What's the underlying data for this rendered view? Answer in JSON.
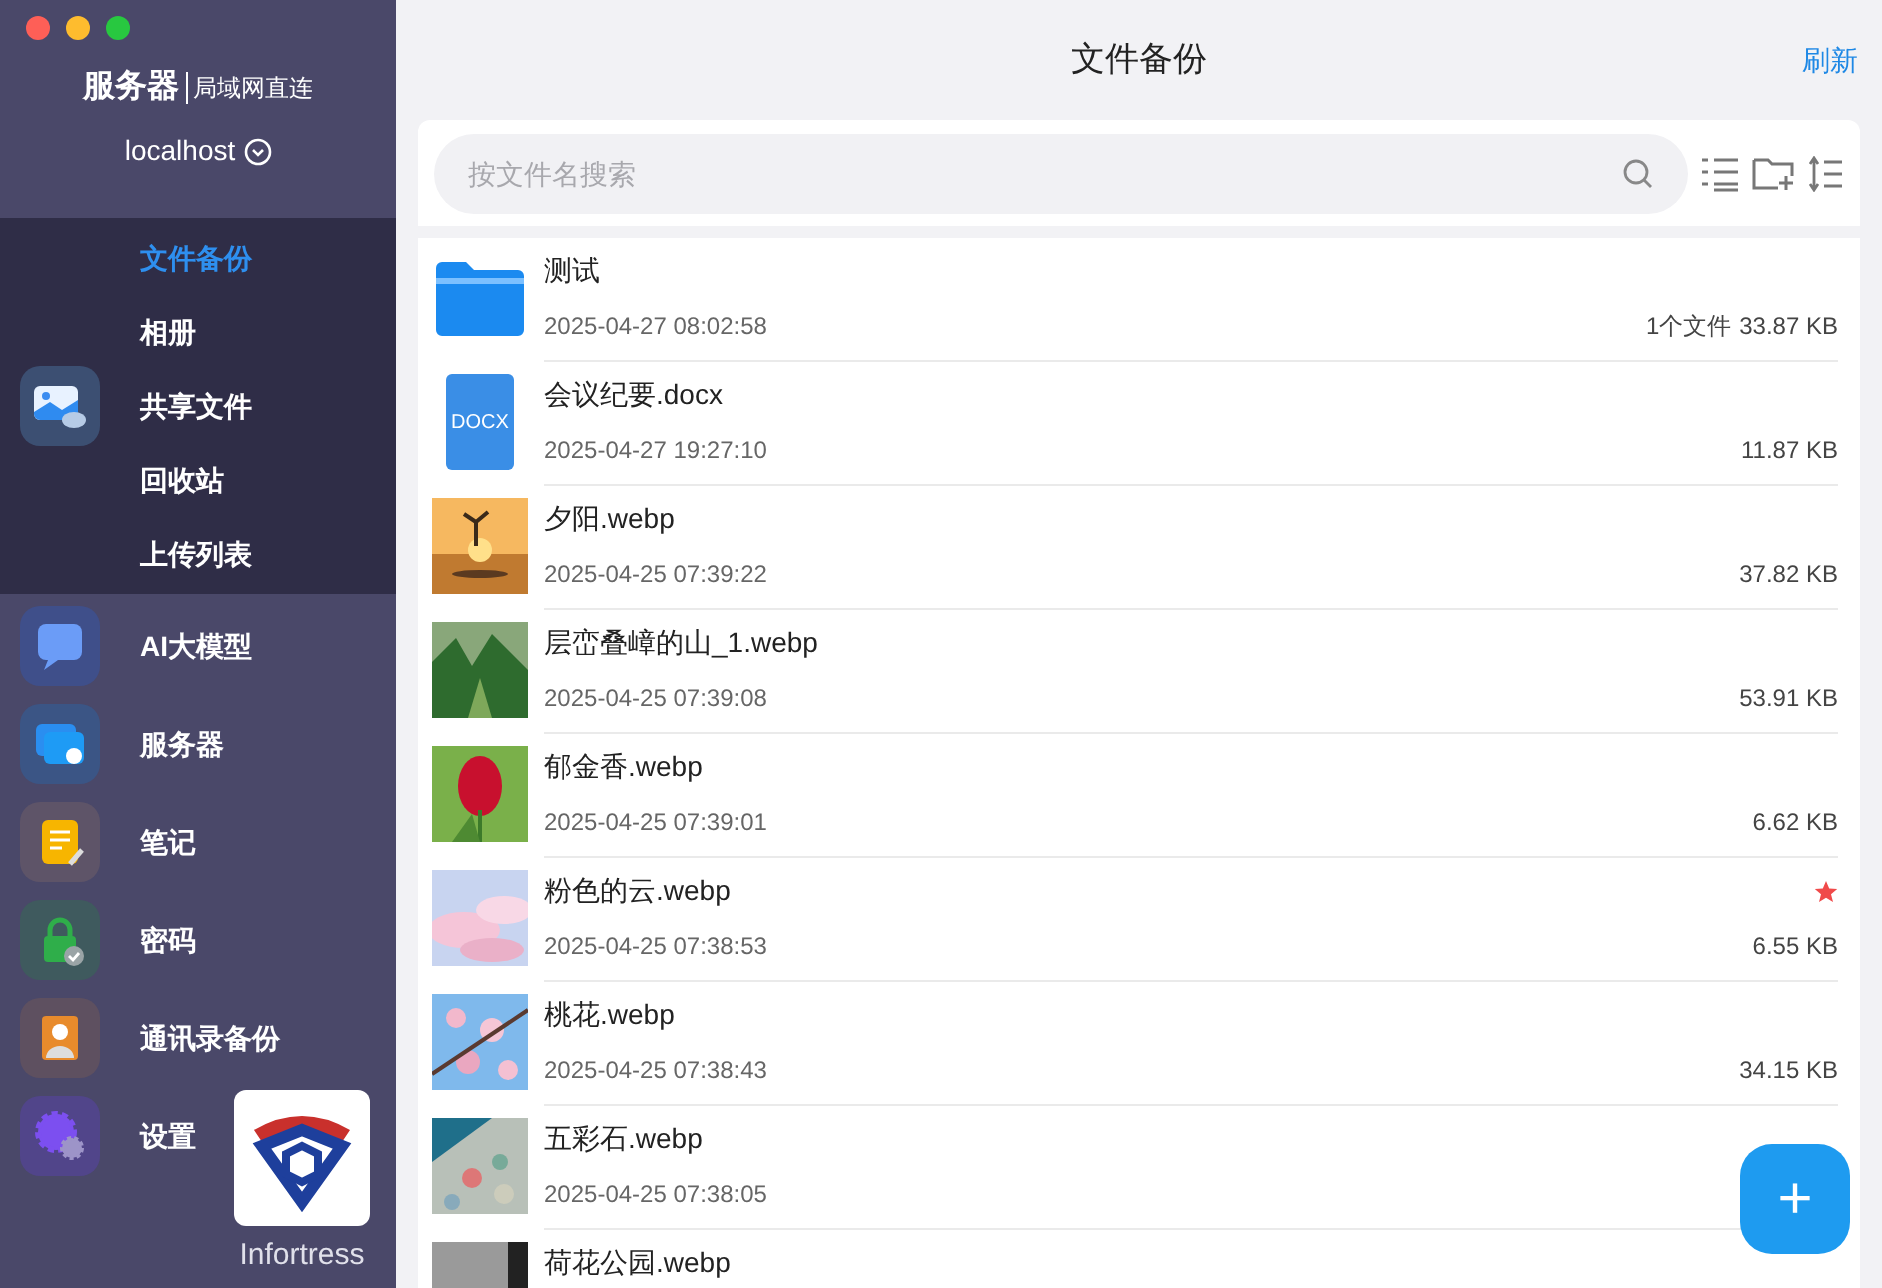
{
  "sidebar": {
    "server_title": "服务器",
    "server_subtitle": "局域网直连",
    "host": "localhost",
    "submenu": [
      {
        "label": "文件备份",
        "selected": true
      },
      {
        "label": "相册",
        "selected": false
      },
      {
        "label": "共享文件",
        "selected": false
      },
      {
        "label": "回收站",
        "selected": false
      },
      {
        "label": "上传列表",
        "selected": false
      }
    ],
    "items": [
      {
        "label": "AI大模型",
        "kind": "ai"
      },
      {
        "label": "服务器",
        "kind": "server"
      },
      {
        "label": "笔记",
        "kind": "note"
      },
      {
        "label": "密码",
        "kind": "password"
      },
      {
        "label": "通讯录备份",
        "kind": "contacts"
      },
      {
        "label": "设置",
        "kind": "settings"
      }
    ],
    "logo_text": "Infortress"
  },
  "header": {
    "title": "文件备份",
    "refresh": "刷新"
  },
  "search": {
    "placeholder": "按文件名搜索"
  },
  "files": [
    {
      "name": "测试",
      "time": "2025-04-27 08:02:58",
      "count": "1个文件",
      "size": "33.87 KB",
      "kind": "folder",
      "starred": false
    },
    {
      "name": "会议纪要.docx",
      "time": "2025-04-27 19:27:10",
      "size": "11.87 KB",
      "kind": "docx",
      "badge": "DOCX",
      "starred": false
    },
    {
      "name": "夕阳.webp",
      "time": "2025-04-25 07:39:22",
      "size": "37.82 KB",
      "starred": false
    },
    {
      "name": "层峦叠嶂的山_1.webp",
      "time": "2025-04-25 07:39:08",
      "size": "53.91 KB",
      "starred": false
    },
    {
      "name": "郁金香.webp",
      "time": "2025-04-25 07:39:01",
      "size": "6.62 KB",
      "starred": false
    },
    {
      "name": "粉色的云.webp",
      "time": "2025-04-25 07:38:53",
      "size": "6.55 KB",
      "starred": true
    },
    {
      "name": "桃花.webp",
      "time": "2025-04-25 07:38:43",
      "size": "34.15 KB",
      "starred": false
    },
    {
      "name": "五彩石.webp",
      "time": "2025-04-25 07:38:05",
      "starred": false
    },
    {
      "name": "荷花公园.webp",
      "starred": false
    }
  ],
  "fab": "+"
}
